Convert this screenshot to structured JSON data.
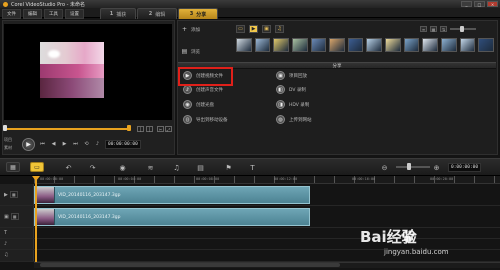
{
  "window": {
    "title": "Corel VideoStudio Pro - 未命名",
    "buttons": [
      "_",
      "□",
      "×"
    ]
  },
  "menu": [
    "文件",
    "编辑",
    "工具",
    "设置"
  ],
  "steps": [
    {
      "num": "1",
      "label": "捕获"
    },
    {
      "num": "2",
      "label": "编辑"
    },
    {
      "num": "3",
      "label": "分享"
    }
  ],
  "preview": {
    "mode_labels": [
      "项目",
      "素材"
    ],
    "timecode": "00:00:00:00",
    "trim_buttons": [
      "[",
      "]"
    ]
  },
  "library": {
    "side_buttons": [
      {
        "icon": "plus-icon",
        "glyph": "+",
        "label": "添加"
      },
      {
        "icon": "browse-icon",
        "glyph": "▤",
        "label": "浏览"
      }
    ],
    "thumb_colors": [
      "#cfd8e0",
      "#9bb7d4",
      "#e0c86a",
      "#a8c0a0",
      "#6b89b5",
      "#d7a46a",
      "#3c5d91",
      "#b6cfe4",
      "#eedb9a",
      "#7aa2c7",
      "#dfe6ee",
      "#8db0d0",
      "#c4d7e9",
      "#2f4d7a"
    ]
  },
  "share": {
    "header": "分享",
    "options_left": [
      {
        "label": "创建视频文件",
        "glyph": "▶"
      },
      {
        "label": "创建声音文件",
        "glyph": "♪"
      },
      {
        "label": "创建光盘",
        "glyph": "◉"
      },
      {
        "label": "导出到移动设备",
        "glyph": "▯"
      }
    ],
    "options_right": [
      {
        "label": "项目回放",
        "glyph": "▣"
      },
      {
        "label": "DV 录制",
        "glyph": "◧"
      },
      {
        "label": "HDV 录制",
        "glyph": "◨"
      },
      {
        "label": "上传到网站",
        "glyph": "◎"
      }
    ]
  },
  "timeline": {
    "timecode": "0:00:00:00",
    "ruler_labels": [
      "00:00:00:00",
      "00:00:04:00",
      "00:00:08:00",
      "00:00:12:00",
      "00:00:16:00",
      "00:00:20:00"
    ],
    "clips": [
      {
        "name": "VID_20140116_203147.3gp"
      },
      {
        "name": "VID_20140116_203147.3gp"
      }
    ]
  },
  "watermark": {
    "logo": "Bai经验",
    "url": "jingyan.baidu.com"
  }
}
